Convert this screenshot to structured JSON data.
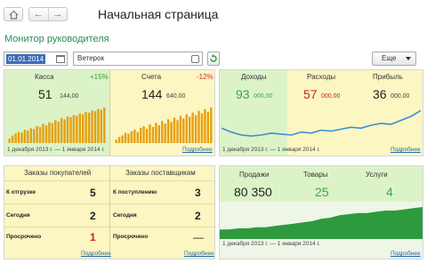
{
  "header": {
    "title": "Начальная страница",
    "nav_back": "←",
    "nav_forward": "→"
  },
  "monitor": {
    "title": "Монитор руководителя",
    "date_value": "01.01.2014",
    "organization_value": "Ветерок",
    "more_label": "Еще"
  },
  "cash_panel": {
    "kassa_label": "Касса",
    "kassa_change": "+15%",
    "kassa_int": "51",
    "kassa_frac": "144,00",
    "accounts_label": "Счета",
    "accounts_change": "-12%",
    "accounts_int": "144",
    "accounts_frac": "640,00",
    "period": "1 декабря 2013 г. — 1 января 2014 г.",
    "more_link": "Подробнее"
  },
  "finance_panel": {
    "income_label": "Доходы",
    "income_int": "93",
    "income_frac": "000,00",
    "expense_label": "Расходы",
    "expense_int": "57",
    "expense_frac": "000,00",
    "profit_label": "Прибыль",
    "profit_int": "36",
    "profit_frac": "000,00",
    "period": "1 декабря 2013 г. — 1 января 2014 г.",
    "more_link": "Подробнее"
  },
  "orders_panel": {
    "customers_label": "Заказы покупателей",
    "suppliers_label": "Заказы поставщикам",
    "customers_rows": [
      {
        "label": "К отгрузке",
        "value": "5"
      },
      {
        "label": "Сегодня",
        "value": "2"
      },
      {
        "label": "Просрочено",
        "value": "1"
      }
    ],
    "suppliers_rows": [
      {
        "label": "К поступлению",
        "value": "3"
      },
      {
        "label": "Сегодня",
        "value": "2"
      },
      {
        "label": "Просрочено",
        "value": "—"
      }
    ],
    "more_link": "Подробнее"
  },
  "sales_panel": {
    "sales_label": "Продажи",
    "sales_value": "80 350",
    "goods_label": "Товары",
    "goods_value": "25",
    "services_label": "Услуги",
    "services_value": "4",
    "period": "1 декабря 2013 г. — 1 января 2014 г.",
    "more_link": "Подробнее"
  },
  "colors": {
    "accent_green": "#2e8b57",
    "income_green": "#3aa64a",
    "expense_red": "#cc2222",
    "bar_orange": "#e6a012",
    "line_blue": "#3a8fd8",
    "area_green": "#2e9a3e"
  },
  "chart_data": [
    {
      "type": "bar",
      "series": [
        {
          "values": [
            6,
            10,
            13,
            15,
            14,
            18,
            17,
            20,
            19,
            23,
            22,
            26,
            24,
            28,
            27,
            31,
            29,
            34,
            32,
            36,
            35,
            38,
            37,
            40,
            39,
            42,
            41,
            44,
            43,
            46,
            45,
            48
          ]
        }
      ]
    },
    {
      "type": "bar",
      "series": [
        {
          "values": [
            4,
            7,
            9,
            12,
            11,
            14,
            16,
            13,
            18,
            20,
            17,
            22,
            19,
            24,
            21,
            26,
            23,
            28,
            25,
            30,
            27,
            32,
            29,
            34,
            31,
            36,
            33,
            38,
            35,
            40,
            37,
            42
          ]
        }
      ]
    },
    {
      "type": "line",
      "series": [
        {
          "values": [
            32,
            28,
            25,
            24,
            25,
            27,
            26,
            25,
            28,
            27,
            30,
            29,
            31,
            33,
            32,
            35,
            37,
            36,
            40,
            44,
            50
          ]
        }
      ]
    },
    {
      "type": "area",
      "series": [
        {
          "values": [
            8,
            8,
            9,
            9,
            10,
            10,
            11,
            12,
            13,
            14,
            15,
            17,
            18,
            20,
            21,
            22,
            22,
            23,
            24,
            24,
            25,
            26,
            27
          ]
        }
      ]
    }
  ]
}
